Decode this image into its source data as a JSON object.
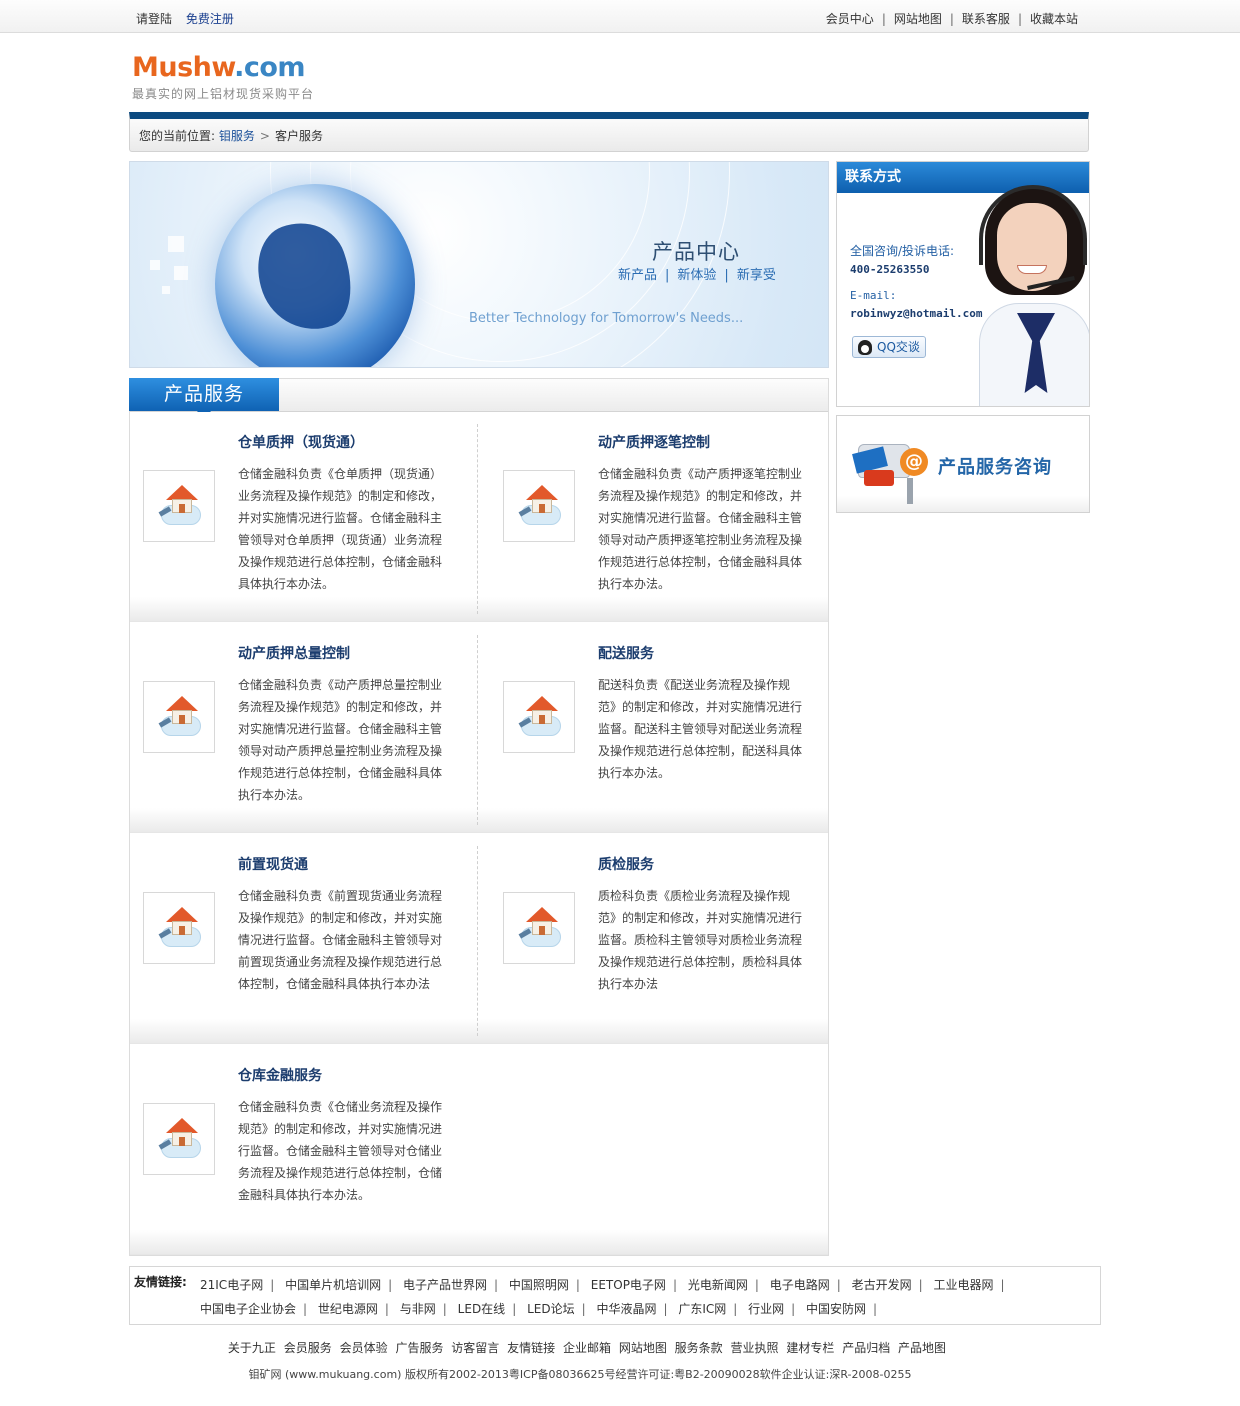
{
  "topbar": {
    "login": "请登陆",
    "register": "免费注册",
    "links": [
      "会员中心",
      "网站地图",
      "联系客服",
      "收藏本站"
    ]
  },
  "logo": {
    "main": "Mushw",
    "domain": ".com",
    "slogan": "最真实的网上铝材现货采购平台"
  },
  "breadcrumb": {
    "label": "您的当前位置:",
    "parent": "钼服务",
    "current": "客户服务"
  },
  "banner": {
    "title": "产品中心",
    "subtitle_items": [
      "新产品",
      "新体验",
      "新享受"
    ],
    "tagline": "Better Technology for Tomorrow's Needs..."
  },
  "services": {
    "header": "产品服务",
    "items": [
      {
        "title": "仓单质押（现货通）",
        "desc": "仓储金融科负责《仓单质押（现货通）业务流程及操作规范》的制定和修改，并对实施情况进行监督。仓储金融科主管领导对仓单质押（现货通）业务流程及操作规范进行总体控制，仓储金融科具体执行本办法。"
      },
      {
        "title": "动产质押逐笔控制",
        "desc": "仓储金融科负责《动产质押逐笔控制业务流程及操作规范》的制定和修改，并对实施情况进行监督。仓储金融科主管领导对动产质押逐笔控制业务流程及操作规范进行总体控制，仓储金融科具体执行本办法。"
      },
      {
        "title": "动产质押总量控制",
        "desc": "仓储金融科负责《动产质押总量控制业务流程及操作规范》的制定和修改，并对实施情况进行监督。仓储金融科主管领导对动产质押总量控制业务流程及操作规范进行总体控制，仓储金融科具体执行本办法。"
      },
      {
        "title": "配送服务",
        "desc": "配送科负责《配送业务流程及操作规范》的制定和修改，并对实施情况进行监督。配送科主管领导对配送业务流程及操作规范进行总体控制，配送科具体执行本办法。"
      },
      {
        "title": "前置现货通",
        "desc": "仓储金融科负责《前置现货通业务流程及操作规范》的制定和修改，并对实施情况进行监督。仓储金融科主管领导对前置现货通业务流程及操作规范进行总体控制，仓储金融科具体执行本办法"
      },
      {
        "title": "质检服务",
        "desc": "质检科负责《质检业务流程及操作规范》的制定和修改，并对实施情况进行监督。质检科主管领导对质检业务流程及操作规范进行总体控制，质检科具体执行本办法"
      },
      {
        "title": "仓库金融服务",
        "desc": "仓储金融科负责《仓储业务流程及操作规范》的制定和修改，并对实施情况进行监督。仓储金融科主管领导对仓储业务流程及操作规范进行总体控制，仓储金融科具体执行本办法。"
      }
    ]
  },
  "contact": {
    "header": "联系方式",
    "phone_label": "全国咨询/投诉电话:",
    "phone": "400-25263550",
    "email_label": "E-mail:",
    "email": "robinwyz@hotmail.com",
    "qq_button": "QQ交谈"
  },
  "consult": {
    "label": "产品服务咨询"
  },
  "friend_links": {
    "label": "友情链接:",
    "items": [
      "21IC电子网",
      "中国单片机培训网",
      "电子产品世界网",
      "中国照明网",
      "EETOP电子网",
      "光电新闻网",
      "电子电路网",
      "老古开发网",
      "工业电器网",
      "中国电子企业协会",
      "世纪电源网",
      "与非网",
      "LED在线",
      "LED论坛",
      "中华液晶网",
      "广东IC网",
      "行业网",
      "中国安防网"
    ]
  },
  "footer": {
    "nav": [
      "关于九正",
      "会员服务",
      "会员体验",
      "广告服务",
      "访客留言",
      "友情链接",
      "企业邮箱",
      "网站地图",
      "服务条款",
      "营业执照",
      "建材专栏",
      "产品归档",
      "产品地图"
    ],
    "copyright": "钼矿网 (www.mukuang.com) 版权所有2002-2013粤ICP备08036625号经营许可证:粤B2-20090028软件企业认证:深R-2008-0255"
  },
  "colors": {
    "navy": "#0c4a80",
    "accent_blue": "#0f62b3",
    "logo_orange": "#e8661e",
    "logo_blue": "#3a86c4"
  }
}
